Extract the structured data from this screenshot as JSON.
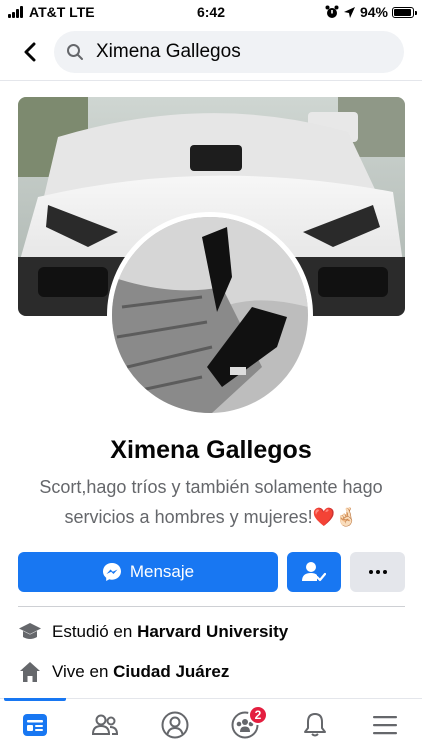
{
  "status_bar": {
    "carrier": "AT&T LTE",
    "time": "6:42",
    "battery": "94%",
    "battery_level": 0.94
  },
  "search": {
    "query": "Ximena Gallegos"
  },
  "profile": {
    "name": "Ximena Gallegos",
    "bio_line1": "Scort,hago tríos y también solamente hago",
    "bio_line2": "servicios a hombres y mujeres!❤️🤞🏻"
  },
  "actions": {
    "message_label": "Mensaje"
  },
  "info": {
    "study_prefix": "Estudió en ",
    "study_place": "Harvard University",
    "lives_prefix": "Vive en ",
    "lives_place": "Ciudad Juárez"
  },
  "tabbar": {
    "groups_badge": "2"
  },
  "colors": {
    "accent": "#1877f2",
    "badge": "#e41e3f"
  }
}
